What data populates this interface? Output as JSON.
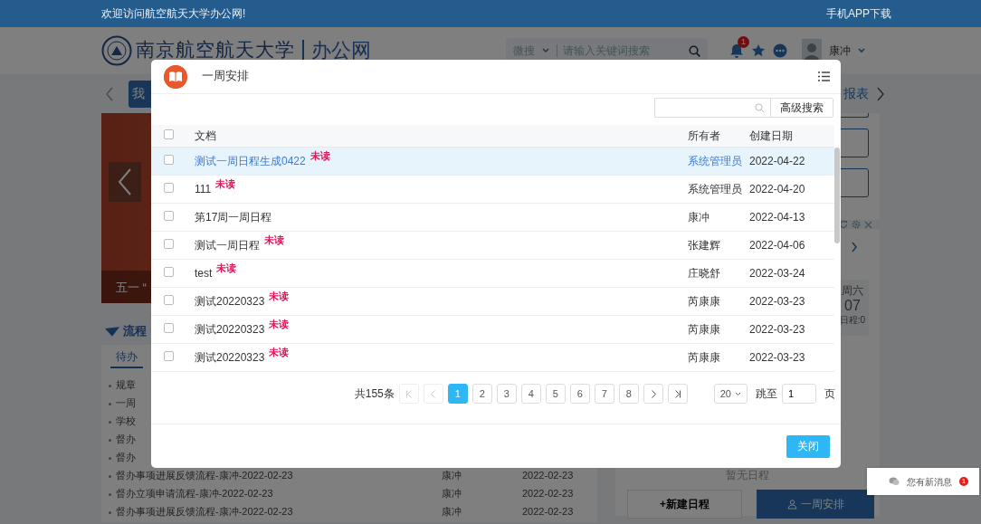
{
  "top_bar": {
    "welcome": "欢迎访问航空航天大学办公网!",
    "app_download": "手机APP下载"
  },
  "header": {
    "logo_text": "南京航空航天大学",
    "site_name": "办公网",
    "search": {
      "scope": "微搜",
      "placeholder": "请输入关键词搜索"
    },
    "notification_count": "1",
    "user_name": "康冲"
  },
  "nav": {
    "left_button": "我",
    "right_item": "报表"
  },
  "carousel": {
    "caption": "五一 “"
  },
  "process_panel": {
    "title": "流程",
    "tab": "待办",
    "items": [
      {
        "title": "规章"
      },
      {
        "title": "一周"
      },
      {
        "title": "学校"
      },
      {
        "title": "督办"
      },
      {
        "title": "督办"
      },
      {
        "title": "督办事项进展反馈流程-康冲-2022-02-23",
        "person": "康冲",
        "date": "2022-02-23"
      },
      {
        "title": "督办立项申请流程-康冲-2022-02-23",
        "person": "康冲",
        "date": "2022-02-23"
      },
      {
        "title": "督办事项进展反馈流程-康冲-2022-02-23",
        "person": "康冲",
        "date": "2022-02-23"
      }
    ]
  },
  "calendar": {
    "day_name": "周六",
    "day": "07",
    "count": "日程:0",
    "empty_text": "暂无日程",
    "new_button": "+新建日程",
    "week_button": "一周安排"
  },
  "dialog": {
    "title": "一周安排",
    "advanced_search": "高级搜索",
    "select_all_checked": false,
    "columns": [
      "文档",
      "所有者",
      "创建日期"
    ],
    "rows": [
      {
        "document": "测试一周日程生成0422",
        "tag": "未读",
        "owner": "系统管理员",
        "date": "2022-04-22",
        "checked": false,
        "selected": true
      },
      {
        "document": "111",
        "tag": "未读",
        "owner": "系统管理员",
        "date": "2022-04-20",
        "checked": false,
        "selected": false
      },
      {
        "document": "第17周一周日程",
        "owner": "康冲",
        "date": "2022-04-13",
        "checked": false,
        "selected": false
      },
      {
        "document": "测试一周日程",
        "tag": "未读",
        "owner": "张建辉",
        "date": "2022-04-06",
        "checked": false,
        "selected": false
      },
      {
        "document": "test",
        "tag": "未读",
        "owner": "庄晓舒",
        "date": "2022-03-24",
        "checked": false,
        "selected": false
      },
      {
        "document": "测试20220323",
        "tag": "未读",
        "owner": "芮康康",
        "date": "2022-03-23",
        "checked": false,
        "selected": false
      },
      {
        "document": "测试20220323",
        "tag": "未读",
        "owner": "芮康康",
        "date": "2022-03-23",
        "checked": false,
        "selected": false
      },
      {
        "document": "测试20220323",
        "tag": "未读",
        "owner": "芮康康",
        "date": "2022-03-23",
        "checked": false,
        "selected": false
      }
    ],
    "pagination": {
      "total": "共155条",
      "first_disabled": true,
      "prev_disabled": true,
      "next_disabled": false,
      "last_disabled": false,
      "pages": [
        {
          "label": "1",
          "selected": true
        },
        {
          "label": "2",
          "selected": false
        },
        {
          "label": "3",
          "selected": false
        },
        {
          "label": "4",
          "selected": false
        },
        {
          "label": "5",
          "selected": false
        },
        {
          "label": "6",
          "selected": false
        },
        {
          "label": "7",
          "selected": false
        },
        {
          "label": "8",
          "selected": false
        }
      ],
      "page_size": "20",
      "jump_label": "跳至",
      "jump_value": "1",
      "page_unit": "页"
    },
    "close_button": "关闭"
  },
  "message_popup": {
    "text": "您有新消息",
    "count": "1"
  }
}
